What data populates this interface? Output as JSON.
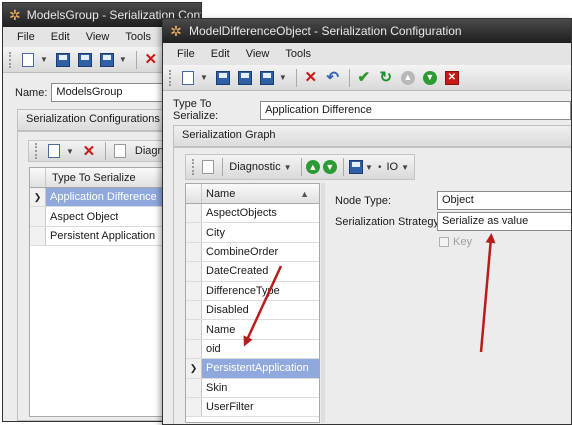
{
  "back_window": {
    "title": "ModelsGroup - Serialization Configuration Group",
    "menu": [
      "File",
      "Edit",
      "View",
      "Tools"
    ],
    "name_label": "Name:",
    "name_value": "ModelsGroup",
    "section_title": "Serialization Configurations",
    "grid_toolbar_label": "Diagnostic",
    "grid_header": "Type To Serialize",
    "rows": [
      "Application Difference",
      "Aspect Object",
      "Persistent Application"
    ],
    "selected_row": 0
  },
  "front_window": {
    "title": "ModelDifferenceObject - Serialization Configuration",
    "menu": [
      "File",
      "Edit",
      "View",
      "Tools"
    ],
    "type_label": "Type To Serialize:",
    "type_value": "Application Difference",
    "graph_title": "Serialization Graph",
    "diag_label": "Diagnostic",
    "io_label": "IO",
    "list_header": "Name",
    "sort_icon": "sort-ascending-icon",
    "members": [
      "AspectObjects",
      "City",
      "CombineOrder",
      "DateCreated",
      "DifferenceType",
      "Disabled",
      "Name",
      "oid",
      "PersistentApplication",
      "Skin",
      "UserFilter"
    ],
    "selected_member": 8,
    "node_type_label": "Node Type:",
    "node_type_value": "Object",
    "strategy_label": "Serialization Strategy:",
    "strategy_value": "Serialize as value",
    "key_label": "Key",
    "key_checked": false
  },
  "colors": {
    "titlebar": "#2b2b2b",
    "selection": "#8fa8de",
    "arrow": "#b81c1c"
  }
}
